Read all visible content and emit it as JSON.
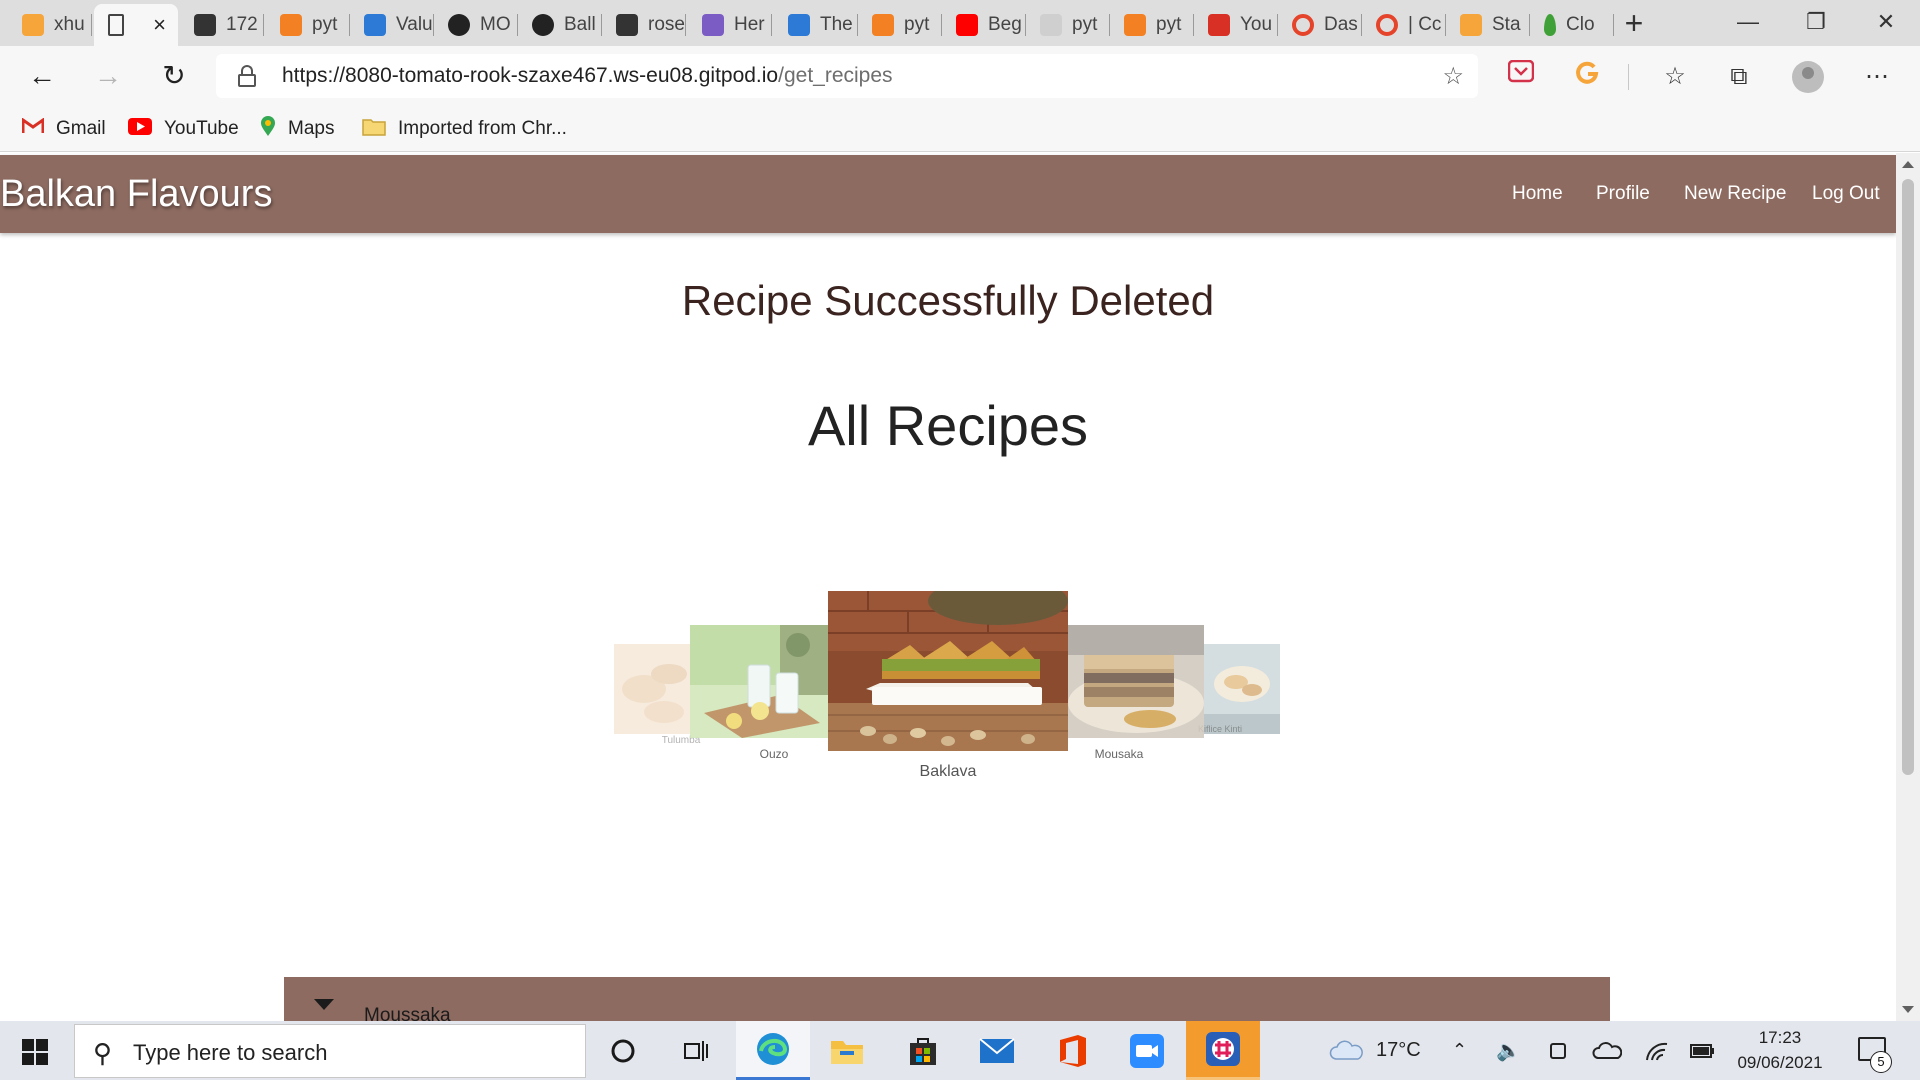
{
  "browser": {
    "tabs": [
      {
        "title": "xhu",
        "icon": "grammarly-icon",
        "color": "#f5a53a"
      },
      {
        "title": "",
        "icon": "page-icon",
        "color": "#ffffff",
        "active": true
      },
      {
        "title": "172",
        "icon": "blocked-page-icon",
        "color": "#333333"
      },
      {
        "title": "pyt",
        "icon": "stackoverflow-icon",
        "color": "#f48024"
      },
      {
        "title": "Valu",
        "icon": "bing-icon",
        "color": "#2d7ad6"
      },
      {
        "title": "MO",
        "icon": "github-icon",
        "color": "#222222"
      },
      {
        "title": "Ball",
        "icon": "github-icon",
        "color": "#222222"
      },
      {
        "title": "rose",
        "icon": "blocked-page-icon",
        "color": "#333333"
      },
      {
        "title": "Her",
        "icon": "heroku-icon",
        "color": "#7b5cc4"
      },
      {
        "title": "The",
        "icon": "bing-icon",
        "color": "#2d7ad6"
      },
      {
        "title": "pyt",
        "icon": "stackoverflow-icon",
        "color": "#f48024"
      },
      {
        "title": "Beg",
        "icon": "youtube-icon",
        "color": "#ff0000"
      },
      {
        "title": "pyt",
        "icon": "cube-icon",
        "color": "#cfcfcf"
      },
      {
        "title": "pyt",
        "icon": "stackoverflow-icon",
        "color": "#f48024"
      },
      {
        "title": "You",
        "icon": "gmail-icon",
        "color": "#d93025"
      },
      {
        "title": "Das",
        "icon": "opera-icon",
        "color": "#e5432a"
      },
      {
        "title": "| Cc",
        "icon": "opera-icon",
        "color": "#e5432a"
      },
      {
        "title": "Sta",
        "icon": "grammarly-icon",
        "color": "#f5a53a"
      },
      {
        "title": "Clo",
        "icon": "mongodb-leaf-icon",
        "color": "#3fa037"
      }
    ],
    "new_tab": "+",
    "url": {
      "host": "https://8080-tomato-rook-szaxe467.ws-eu08.gitpod.io",
      "path": "/get_recipes"
    },
    "bookmarks": [
      {
        "label": "Gmail",
        "icon": "gmail-icon"
      },
      {
        "label": "YouTube",
        "icon": "youtube-icon"
      },
      {
        "label": "Maps",
        "icon": "maps-pin-icon"
      },
      {
        "label": "Imported from Chr...",
        "icon": "folder-icon"
      }
    ]
  },
  "site": {
    "brand": "Balkan Flavours",
    "nav": [
      "Home",
      "Profile",
      "New Recipe",
      "Log Out"
    ],
    "flash_message": "Recipe Successfully Deleted",
    "heading": "All Recipes",
    "carousel": [
      {
        "caption": "Tulumba",
        "image": "tulumba-photo"
      },
      {
        "caption": "Ouzo",
        "image": "ouzo-photo"
      },
      {
        "caption": "Baklava",
        "image": "baklava-photo",
        "active": true
      },
      {
        "caption": "Mousaka",
        "image": "mousaka-photo"
      },
      {
        "caption": "Kiflice Kinti",
        "image": "kiflice-photo"
      }
    ],
    "recipe_list": [
      {
        "title": "Moussaka"
      }
    ],
    "colors": {
      "nav": "#8d6b61",
      "flash": "#3b2420"
    }
  },
  "taskbar": {
    "search_placeholder": "Type here to search",
    "apps": [
      "cortana-icon",
      "task-view-icon",
      "edge-icon",
      "file-explorer-icon",
      "store-icon",
      "mail-icon",
      "office-icon",
      "zoom-icon",
      "slack-icon"
    ],
    "temperature": "17°C",
    "time": "17:23",
    "date": "09/06/2021",
    "notifications": "5"
  }
}
